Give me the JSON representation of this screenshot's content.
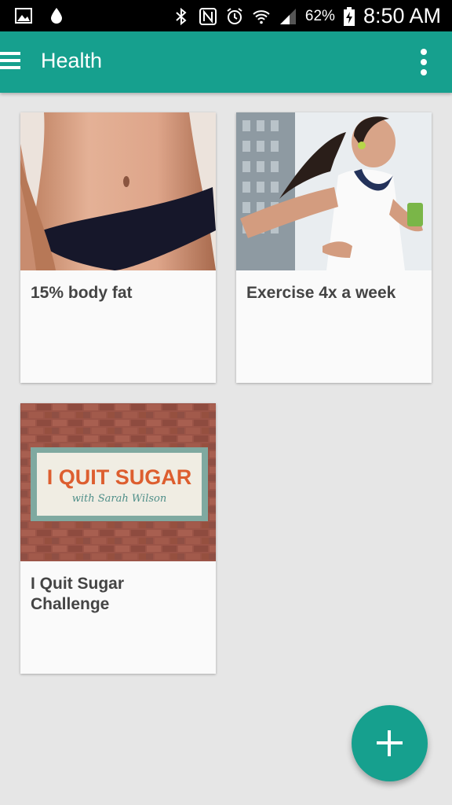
{
  "status_bar": {
    "battery_percent": "62%",
    "time": "8:50 AM",
    "icons": [
      "image-icon",
      "water-drop-icon",
      "bluetooth-icon",
      "nfc-icon",
      "alarm-icon",
      "wifi-icon",
      "signal-icon",
      "battery-charging-icon"
    ]
  },
  "app_bar": {
    "title": "Health",
    "menu_icon": "hamburger-menu-icon",
    "overflow_icon": "more-vert-icon"
  },
  "cards": [
    {
      "title": "15% body fat",
      "image": "body-fat-photo"
    },
    {
      "title": "Exercise 4x a week",
      "image": "runner-photo"
    },
    {
      "title": "I Quit Sugar Challenge",
      "image": "quit-sugar-sign-photo",
      "sign_text": "I QUIT SUGAR",
      "sign_subtext": "with Sarah Wilson"
    }
  ],
  "fab": {
    "icon": "plus-icon"
  },
  "colors": {
    "accent": "#16a08e",
    "background": "#e6e6e6",
    "card": "#fafafa"
  }
}
